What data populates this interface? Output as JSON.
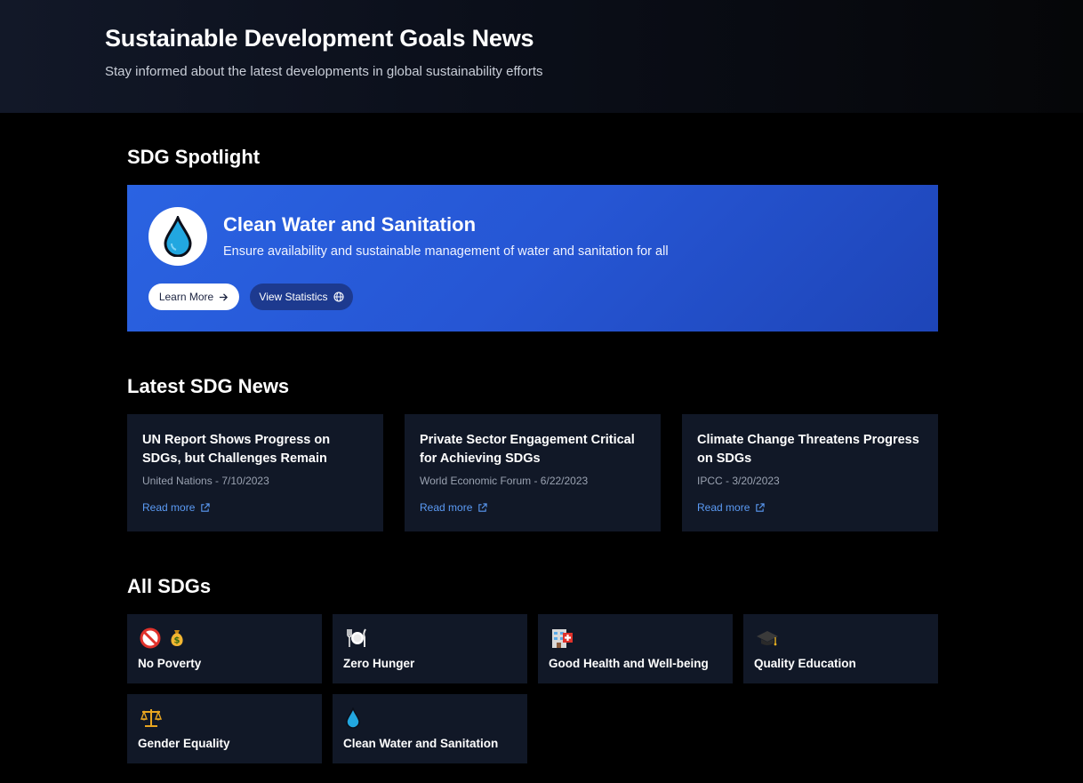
{
  "header": {
    "title": "Sustainable Development Goals News",
    "subtitle": "Stay informed about the latest developments in global sustainability efforts"
  },
  "spotlight": {
    "heading": "SDG Spotlight",
    "title": "Clean Water and Sanitation",
    "description": "Ensure availability and sustainable management of water and sanitation for all",
    "icon": "water-drop-icon",
    "learn_more_label": "Learn More",
    "view_stats_label": "View Statistics",
    "colors": {
      "background": "#2a63e2",
      "accent_button": "#1d3a8f"
    }
  },
  "news": {
    "heading": "Latest SDG News",
    "items": [
      {
        "title": "UN Report Shows Progress on SDGs, but Challenges Remain",
        "meta": "United Nations - 7/10/2023",
        "link_label": "Read more"
      },
      {
        "title": "Private Sector Engagement Critical for Achieving SDGs",
        "meta": "World Economic Forum - 6/22/2023",
        "link_label": "Read more"
      },
      {
        "title": "Climate Change Threatens Progress on SDGs",
        "meta": "IPCC - 3/20/2023",
        "link_label": "Read more"
      }
    ]
  },
  "all_sdgs": {
    "heading": "All SDGs",
    "items": [
      {
        "label": "No Poverty",
        "icons": [
          "prohibited-icon",
          "money-bag-icon"
        ]
      },
      {
        "label": "Zero Hunger",
        "icons": [
          "plate-cutlery-icon"
        ]
      },
      {
        "label": "Good Health and Well-being",
        "icons": [
          "hospital-icon"
        ]
      },
      {
        "label": "Quality Education",
        "icons": [
          "graduation-cap-icon"
        ]
      },
      {
        "label": "Gender Equality",
        "icons": [
          "balance-scale-icon"
        ]
      },
      {
        "label": "Clean Water and Sanitation",
        "icons": [
          "water-drop-icon"
        ]
      }
    ]
  }
}
